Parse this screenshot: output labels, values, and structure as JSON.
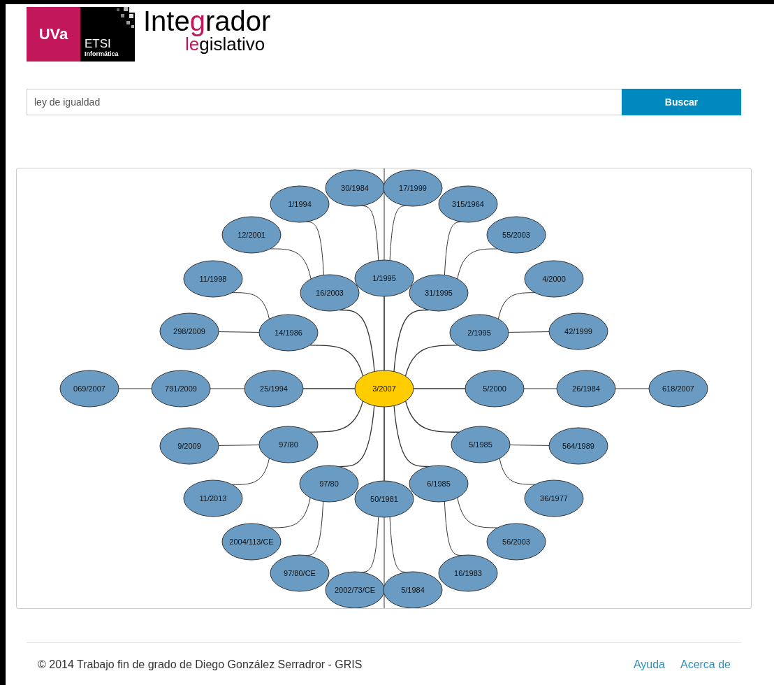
{
  "header": {
    "logo": {
      "university": "UVa",
      "school": "ETSI",
      "faculty": "Informática",
      "title_parts": [
        {
          "text": "Inte",
          "accent": false
        },
        {
          "text": "g",
          "accent": true
        },
        {
          "text": "rador",
          "accent": false
        }
      ],
      "subtitle_parts": [
        {
          "text": "le",
          "accent": true
        },
        {
          "text": "gislativo",
          "accent": false
        }
      ]
    }
  },
  "search": {
    "value": "ley de igualdad",
    "button": "Buscar"
  },
  "graph": {
    "root": {
      "label": "3/2007",
      "highlighted": true,
      "children": [
        {
          "label": "1/1995",
          "highlighted": false,
          "children": [
            {
              "label": "30/1984",
              "highlighted": false
            },
            {
              "label": "17/1999",
              "highlighted": false
            }
          ]
        },
        {
          "label": "16/2003",
          "highlighted": false,
          "children": [
            {
              "label": "1/1994",
              "highlighted": false
            },
            {
              "label": "12/2001",
              "highlighted": false
            }
          ]
        },
        {
          "label": "31/1995",
          "highlighted": false,
          "children": [
            {
              "label": "315/1964",
              "highlighted": false
            },
            {
              "label": "55/2003",
              "highlighted": false
            }
          ]
        },
        {
          "label": "14/1986",
          "highlighted": false,
          "children": [
            {
              "label": "11/1998",
              "highlighted": false
            },
            {
              "label": "298/2009",
              "highlighted": false
            }
          ]
        },
        {
          "label": "2/1995",
          "highlighted": false,
          "children": [
            {
              "label": "4/2000",
              "highlighted": false
            },
            {
              "label": "42/1999",
              "highlighted": false
            }
          ]
        },
        {
          "label": "25/1994",
          "highlighted": false,
          "children": [
            {
              "label": "791/2009",
              "highlighted": false,
              "children": [
                {
                  "label": "069/2007",
                  "highlighted": false
                }
              ]
            }
          ]
        },
        {
          "label": "5/2000",
          "highlighted": false,
          "children": [
            {
              "label": "26/1984",
              "highlighted": false,
              "children": [
                {
                  "label": "618/2007",
                  "highlighted": false
                }
              ]
            }
          ]
        },
        {
          "label": "97/80",
          "highlighted": false,
          "children": [
            {
              "label": "9/2009",
              "highlighted": false
            },
            {
              "label": "11/2013",
              "highlighted": false
            }
          ]
        },
        {
          "label": "5/1985",
          "highlighted": false,
          "children": [
            {
              "label": "564/1989",
              "highlighted": false
            },
            {
              "label": "36/1977",
              "highlighted": false
            }
          ]
        },
        {
          "label": "97/80",
          "highlighted": false,
          "children": [
            {
              "label": "2004/113/CE",
              "highlighted": false
            },
            {
              "label": "97/80/CE",
              "highlighted": false
            }
          ]
        },
        {
          "label": "6/1985",
          "highlighted": false,
          "children": [
            {
              "label": "56/2003",
              "highlighted": false
            },
            {
              "label": "16/1983",
              "highlighted": false
            }
          ]
        },
        {
          "label": "50/1981",
          "highlighted": false,
          "children": [
            {
              "label": "2002/73/CE",
              "highlighted": false
            },
            {
              "label": "5/1984",
              "highlighted": false
            }
          ]
        }
      ]
    }
  },
  "footer": {
    "copyright": "© 2014 Trabajo fin de grado de Diego González Serradror - GRIS",
    "links": [
      "Ayuda",
      "Acerca de"
    ]
  }
}
